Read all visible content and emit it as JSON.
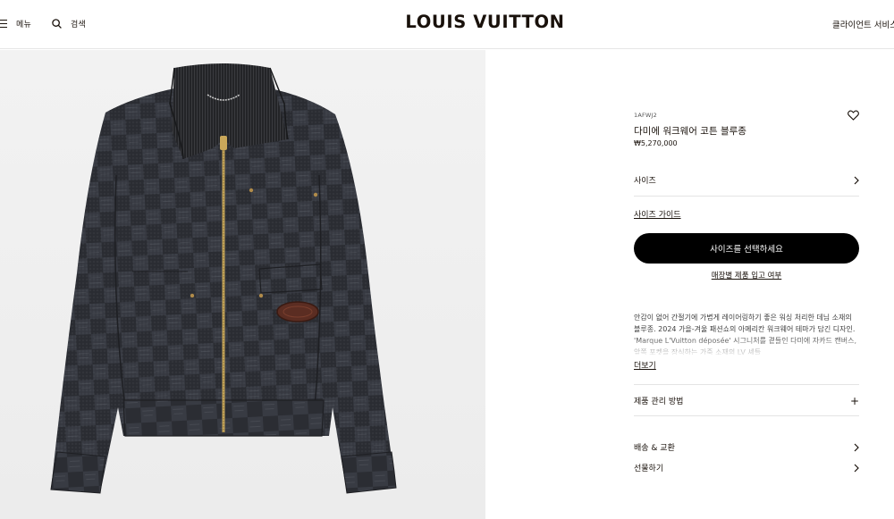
{
  "header": {
    "menu_label": "메뉴",
    "search_label": "검색",
    "logo": "LOUIS VUITTON",
    "client_service": "클라이언트 서비스"
  },
  "product": {
    "sku": "1AFWJ2",
    "name": "다미에 워크웨어 코튼 블루종",
    "price": "₩5,270,000",
    "size_label": "사이즈",
    "size_guide": "사이즈 가이드",
    "cta": "사이즈를 선택하세요",
    "store_stock": "매장별 제품 입고 여부",
    "description": "안감이 없어 간절기에 가볍게 레이어링하기 좋은 워싱 처리한 데님 소재의 블루종. 2024 가을-겨울 패션쇼의 아메리칸 워크웨어 테마가 담긴 디자인. 'Marque L'Vuitton déposée' 시그니처를 곁들인 다미에 자카드 캔버스, 앞쪽 포켓을 장식하는 가죽 소재의 LV 셰들",
    "more": "더보기",
    "care_label": "제품 관리 방법",
    "care_icon": "+",
    "delivery_label": "배송 & 교환",
    "gift_label": "선물하기"
  },
  "icons": {
    "menu": "hamburger-icon",
    "search": "search-icon",
    "wishlist": "heart-icon",
    "chevron": "chevron-right-icon"
  },
  "colors": {
    "text": "#19110b",
    "cta_bg": "#000000",
    "image_bg": "#efefef"
  }
}
